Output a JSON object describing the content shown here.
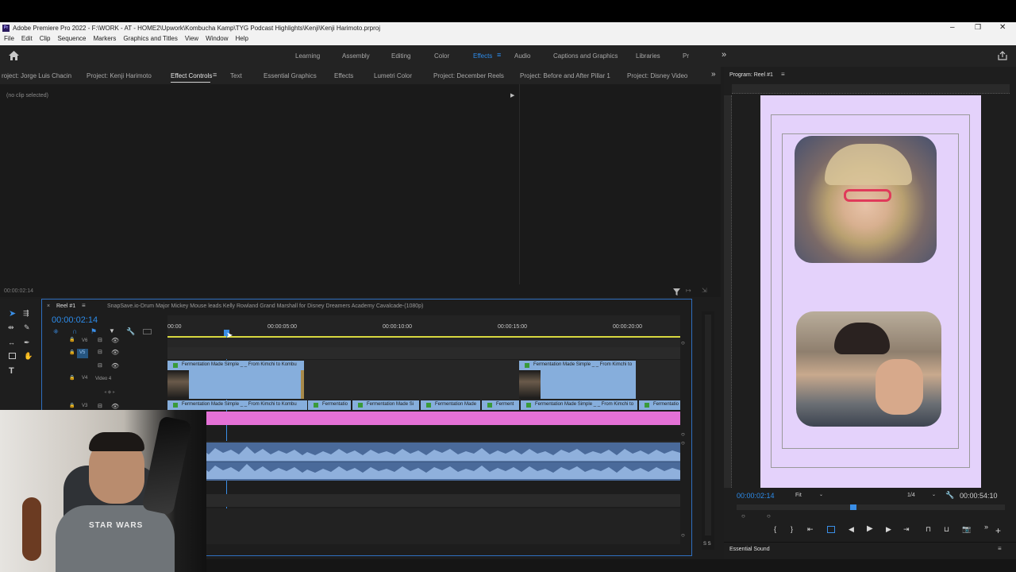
{
  "window": {
    "title": "Adobe Premiere Pro 2022 - F:\\WORK - AT - HOME2\\Upwork\\Kombucha Kamp\\TYG Podcast Highlights\\Kenji\\Kenji Harimoto.prproj",
    "app_badge": "Pr"
  },
  "menu": [
    "File",
    "Edit",
    "Clip",
    "Sequence",
    "Markers",
    "Graphics and Titles",
    "View",
    "Window",
    "Help"
  ],
  "workspaces": {
    "items": [
      "Learning",
      "Assembly",
      "Editing",
      "Color",
      "Effects",
      "Audio",
      "Captions and Graphics",
      "Libraries",
      "Pr"
    ],
    "active": "Effects",
    "overflow": "»"
  },
  "panel_tabs": {
    "items": [
      "roject: Jorge Luis Chacin",
      "Project: Kenji Harimoto",
      "Effect Controls",
      "Text",
      "Essential Graphics",
      "Effects",
      "Lumetri Color",
      "Project: December Reels",
      "Project: Before and After Pillar 1",
      "Project: Disney Video"
    ],
    "active": "Effect Controls",
    "overflow": "»"
  },
  "effect_controls": {
    "no_clip": "(no clip selected)",
    "timecode": "00:00:02:14"
  },
  "program": {
    "title": "Program: Reel #1",
    "timecode": "00:00:02:14",
    "fit": "Fit",
    "resolution": "1/4",
    "duration": "00:00:54:10",
    "playhead_fraction": 0.047
  },
  "timeline": {
    "sequence_tab": "Reel #1",
    "other_tab": "SnapSave.io-Drum Major Mickey Mouse leads Kelly Rowland Grand Marshall for Disney Dreamers Academy Cavalcade-(1080p)",
    "timecode": "00:00:02:14",
    "ruler": [
      "00:00",
      "00:00:05:00",
      "00:00:10:00",
      "00:00:15:00",
      "00:00:20:00"
    ],
    "tracks": {
      "v6": "V6",
      "v5": "V5",
      "v4": "V4",
      "v4_name": "Video 4",
      "v3": "V3"
    },
    "clips_v4": [
      "Fermentation Made Simple _ _ From Kimchi to Kombu",
      "Fermentation Made Simple _ _ From Kimchi to"
    ],
    "clips_v3": [
      "Fermentation Made Simple _ _ From Kimchi to Kombu",
      "Fermentatio",
      "Fermentation Made Si",
      "Fermentation Made",
      "Ferment",
      "Fermentation Made Simple _ _ From Kimchi to",
      "Fermentatio"
    ],
    "audio_meter_label": "S S"
  },
  "bottom": {
    "essential_sound": "Essential Sound"
  },
  "webcam_shirt_text": "STAR WARS",
  "colors": {
    "accent": "#2d8ceb",
    "clip_blue": "#86aedc",
    "clip_pink": "#e471d6",
    "frame_bg": "#e4d2fb",
    "audio_wave": "#6b8fc5"
  }
}
